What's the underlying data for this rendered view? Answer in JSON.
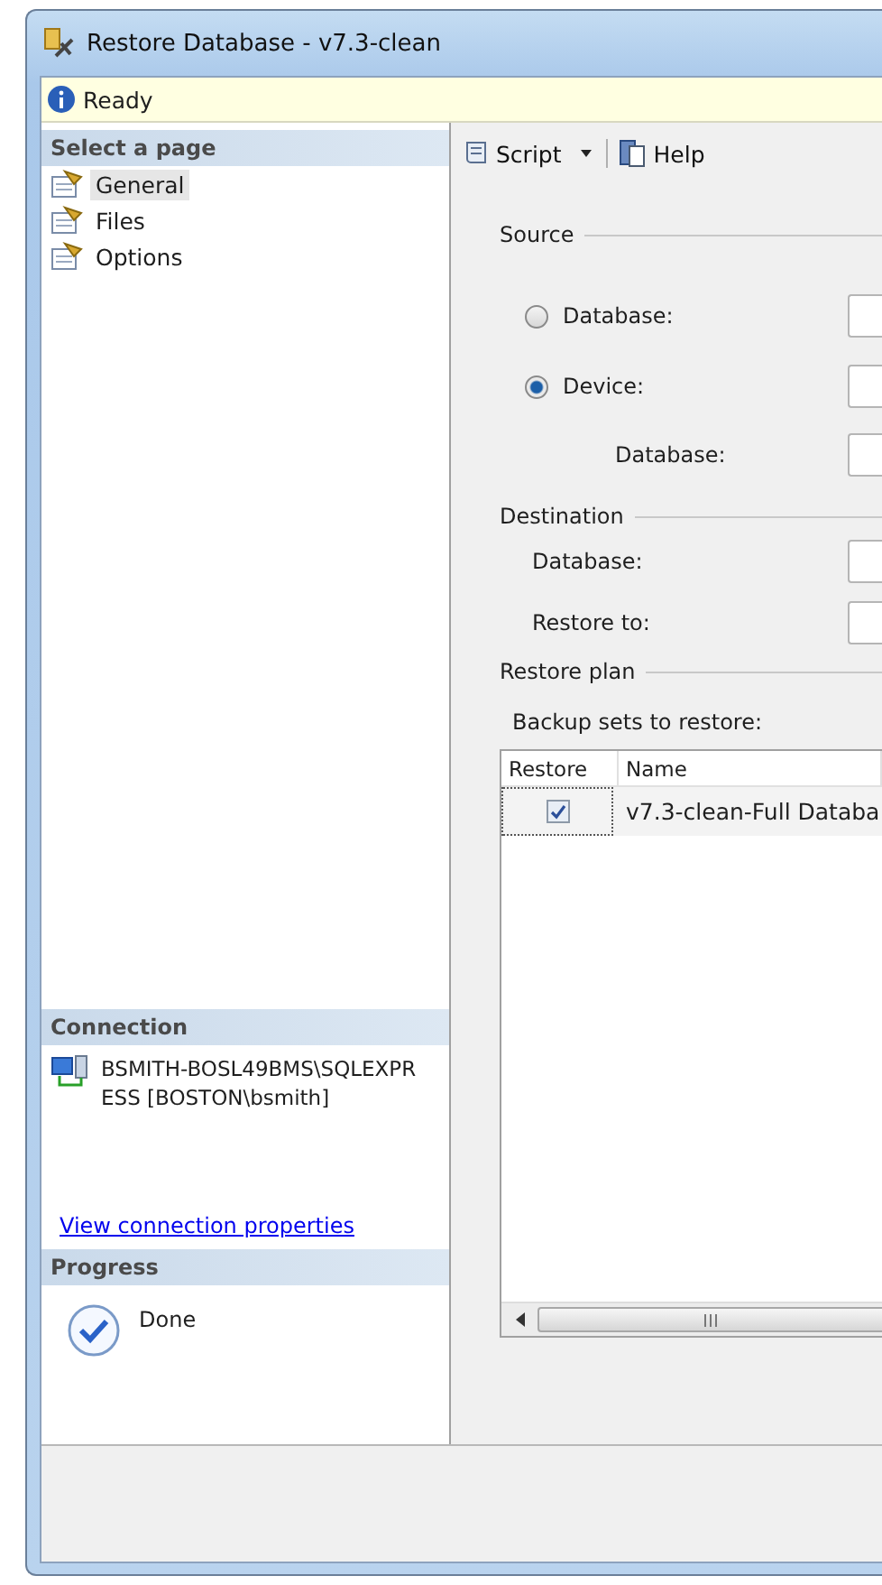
{
  "window": {
    "title": "Restore Database - v7.3-clean"
  },
  "status": {
    "text": "Ready"
  },
  "sidebar": {
    "header": "Select a page",
    "items": [
      {
        "label": "General",
        "selected": true
      },
      {
        "label": "Files",
        "selected": false
      },
      {
        "label": "Options",
        "selected": false
      }
    ]
  },
  "connection": {
    "header": "Connection",
    "server": "BSMITH-BOSL49BMS\\SQLEXPRESS [BOSTON\\bsmith]",
    "link": "View connection properties"
  },
  "progress": {
    "header": "Progress",
    "text": "Done"
  },
  "toolbar": {
    "script": "Script",
    "help": "Help"
  },
  "source": {
    "title": "Source",
    "options": [
      {
        "label": "Database:",
        "selected": false
      },
      {
        "label": "Device:",
        "selected": true
      }
    ],
    "device_database_label": "Database:"
  },
  "destination": {
    "title": "Destination",
    "fields": [
      {
        "label": "Database:"
      },
      {
        "label": "Restore to:"
      }
    ]
  },
  "restore_plan": {
    "title": "Restore plan",
    "caption": "Backup sets to restore:",
    "columns": [
      "Restore",
      "Name"
    ],
    "rows": [
      {
        "checked": true,
        "name": "v7.3-clean-Full Databa"
      }
    ]
  }
}
